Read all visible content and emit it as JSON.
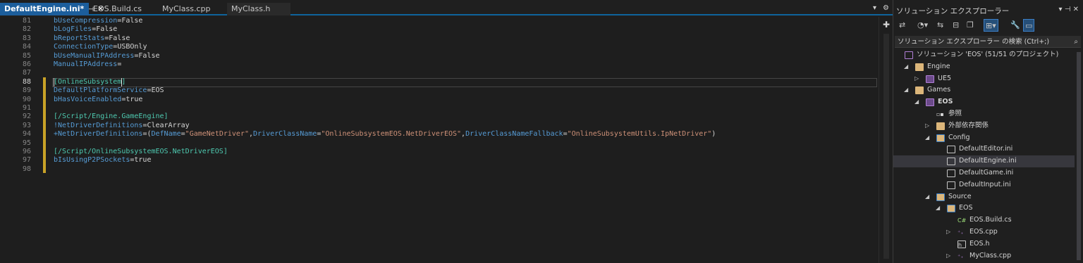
{
  "tabs": [
    {
      "label": "DefaultEngine.ini*",
      "active": true
    },
    {
      "label": "EOS.Build.cs"
    },
    {
      "label": "MyClass.cpp"
    },
    {
      "label": "MyClass.h"
    }
  ],
  "editor": {
    "line_numbers": [
      "81",
      "82",
      "83",
      "84",
      "85",
      "86",
      "87",
      "88",
      "89",
      "90",
      "91",
      "92",
      "93",
      "94",
      "95",
      "96",
      "97",
      "98"
    ],
    "lines": [
      [
        {
          "t": "bUseCompression",
          "c": "k"
        },
        {
          "t": "=False",
          "c": "v"
        }
      ],
      [
        {
          "t": "bLogFiles",
          "c": "k"
        },
        {
          "t": "=False",
          "c": "v"
        }
      ],
      [
        {
          "t": "bReportStats",
          "c": "k"
        },
        {
          "t": "=False",
          "c": "v"
        }
      ],
      [
        {
          "t": "ConnectionType",
          "c": "k"
        },
        {
          "t": "=USBOnly",
          "c": "v"
        }
      ],
      [
        {
          "t": "bUseManualIPAddress",
          "c": "k"
        },
        {
          "t": "=False",
          "c": "v"
        }
      ],
      [
        {
          "t": "ManualIPAddress",
          "c": "k"
        },
        {
          "t": "=",
          "c": "v"
        }
      ],
      [],
      [
        {
          "t": "[OnlineSubsystem]",
          "c": "s"
        }
      ],
      [
        {
          "t": "DefaultPlatformService",
          "c": "k"
        },
        {
          "t": "=EOS",
          "c": "v"
        }
      ],
      [
        {
          "t": "bHasVoiceEnabled",
          "c": "k"
        },
        {
          "t": "=true",
          "c": "v"
        }
      ],
      [],
      [
        {
          "t": "[/Script/Engine.GameEngine]",
          "c": "s"
        }
      ],
      [
        {
          "t": "!NetDriverDefinitions",
          "c": "k"
        },
        {
          "t": "=ClearArray",
          "c": "v"
        }
      ],
      [
        {
          "t": "+NetDriverDefinitions",
          "c": "k"
        },
        {
          "t": "=(",
          "c": "v"
        },
        {
          "t": "DefName",
          "c": "k"
        },
        {
          "t": "=",
          "c": "v"
        },
        {
          "t": "\"GameNetDriver\"",
          "c": "str"
        },
        {
          "t": ",",
          "c": "v"
        },
        {
          "t": "DriverClassName",
          "c": "k"
        },
        {
          "t": "=",
          "c": "v"
        },
        {
          "t": "\"OnlineSubsystemEOS.NetDriverEOS\"",
          "c": "str"
        },
        {
          "t": ",",
          "c": "v"
        },
        {
          "t": "DriverClassNameFallback",
          "c": "k"
        },
        {
          "t": "=",
          "c": "v"
        },
        {
          "t": "\"OnlineSubsystemUtils.IpNetDriver\"",
          "c": "str"
        },
        {
          "t": ")",
          "c": "v"
        }
      ],
      [],
      [
        {
          "t": "[/Script/OnlineSubsystemEOS.NetDriverEOS]",
          "c": "s"
        }
      ],
      [
        {
          "t": "bIsUsingP2PSockets",
          "c": "k"
        },
        {
          "t": "=true",
          "c": "v"
        }
      ],
      []
    ],
    "current_line": "88"
  },
  "solution_explorer": {
    "title": "ソリューション エクスプローラー",
    "search_placeholder": "ソリューション エクスプローラー の検索 (Ctrl+;)",
    "items": [
      {
        "label": "ソリューション 'EOS' (51/51 のプロジェクト)",
        "icon": "solution-icon",
        "level": 0,
        "arrow": ""
      },
      {
        "label": "Engine",
        "icon": "folder-icon",
        "level": 1,
        "arrow": "◢"
      },
      {
        "label": "UE5",
        "icon": "project-icon",
        "level": 2,
        "arrow": "▷"
      },
      {
        "label": "Games",
        "icon": "folder-icon",
        "level": 1,
        "arrow": "◢"
      },
      {
        "label": "EOS",
        "icon": "project-icon",
        "level": 2,
        "arrow": "◢",
        "bold": true
      },
      {
        "label": "参照",
        "icon": "references-icon",
        "level": 3,
        "arrow": ""
      },
      {
        "label": "外部依存関係",
        "icon": "external-deps-icon",
        "level": 3,
        "arrow": "▷"
      },
      {
        "label": "Config",
        "icon": "filter-folder-icon",
        "level": 3,
        "arrow": "◢"
      },
      {
        "label": "DefaultEditor.ini",
        "icon": "ini-file-icon",
        "level": 4,
        "arrow": ""
      },
      {
        "label": "DefaultEngine.ini",
        "icon": "ini-file-icon",
        "level": 4,
        "arrow": "",
        "selected": true
      },
      {
        "label": "DefaultGame.ini",
        "icon": "ini-file-icon",
        "level": 4,
        "arrow": ""
      },
      {
        "label": "DefaultInput.ini",
        "icon": "ini-file-icon",
        "level": 4,
        "arrow": ""
      },
      {
        "label": "Source",
        "icon": "filter-folder-icon",
        "level": 3,
        "arrow": "◢"
      },
      {
        "label": "EOS",
        "icon": "filter-folder-icon",
        "level": 4,
        "arrow": "◢"
      },
      {
        "label": "EOS.Build.cs",
        "icon": "csharp-file-icon",
        "level": 5,
        "arrow": ""
      },
      {
        "label": "EOS.cpp",
        "icon": "cpp-file-icon",
        "level": 5,
        "arrow": "▷"
      },
      {
        "label": "EOS.h",
        "icon": "header-file-icon",
        "level": 5,
        "arrow": ""
      },
      {
        "label": "MyClass.cpp",
        "icon": "cpp-file-icon",
        "level": 5,
        "arrow": "▷"
      }
    ]
  },
  "colors": {
    "accent": "#1c5e9c",
    "keyword": "#569cd6",
    "section": "#4ec9b0",
    "string": "#ce9178",
    "modified_margin": "#c9a227"
  }
}
